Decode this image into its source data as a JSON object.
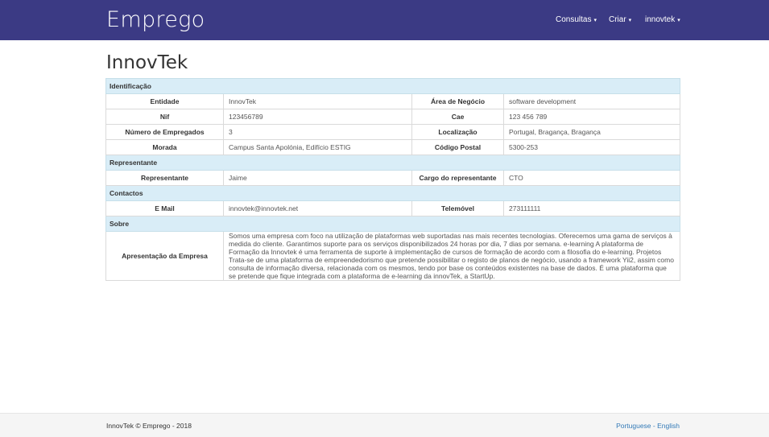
{
  "navbar": {
    "brand": "Emprego",
    "items": [
      {
        "label": "Consultas"
      },
      {
        "label": "Criar"
      },
      {
        "label": "innovtek"
      }
    ],
    "caret": "▾"
  },
  "page": {
    "title": "InnovTek"
  },
  "sections": {
    "identificacao": {
      "title": "Identificação",
      "rows": [
        {
          "l1": "Entidade",
          "v1": "InnovTek",
          "l2": "Área de Negócio",
          "v2": "software development"
        },
        {
          "l1": "Nif",
          "v1": "123456789",
          "l2": "Cae",
          "v2": "123 456 789"
        },
        {
          "l1": "Número de Empregados",
          "v1": "3",
          "l2": "Localização",
          "v2": "Portugal, Bragança, Bragança"
        },
        {
          "l1": "Morada",
          "v1": "Campus Santa Apolónia, Edifício ESTIG",
          "l2": "Código Postal",
          "v2": "5300-253"
        }
      ]
    },
    "representante": {
      "title": "Representante",
      "rows": [
        {
          "l1": "Representante",
          "v1": "Jaime",
          "l2": "Cargo do representante",
          "v2": "CTO"
        }
      ]
    },
    "contactos": {
      "title": "Contactos",
      "rows": [
        {
          "l1": "E Mail",
          "v1": "innovtek@innovtek.net",
          "l2": "Telemóvel",
          "v2": "273111111"
        }
      ]
    },
    "sobre": {
      "title": "Sobre",
      "label": "Apresentação da Empresa",
      "text": "Somos uma empresa com foco na utilização de plataformas web suportadas nas mais recentes tecnologias. Oferecemos uma gama de serviços à medida do cliente. Garantimos suporte para os serviços disponibilizados 24 horas por dia, 7 dias por semana. e-learning A plataforma de Formação da Innovtek é uma ferramenta de suporte à implementação de cursos de formação de acordo com a filosofia do e-learning. Projetos Trata-se de uma plataforma de empreendedorismo que pretende possibilitar o registo de planos de negócio, usando a framework Yii2, assim como consulta de informação diversa, relacionada com os mesmos, tendo por base os conteúdos existentes na base de dados. É uma plataforma que se pretende que fique integrada com a plataforma de e-learning da innovTek, a StartUp."
    }
  },
  "footer": {
    "copyright": "InnovTek © Emprego - 2018",
    "lang_pt": "Portuguese",
    "separator": " - ",
    "lang_en": "English"
  },
  "colors": {
    "navbar_bg": "#3b3a84",
    "section_bg": "#d9edf7",
    "link": "#337ab7"
  }
}
